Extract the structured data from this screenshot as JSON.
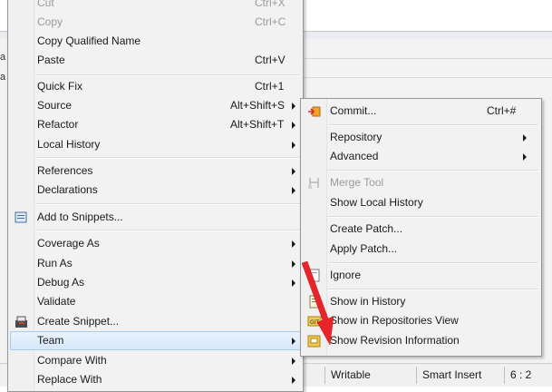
{
  "background": {
    "left_letters": [
      "a",
      "a"
    ],
    "status_bar": {
      "writable": "Writable",
      "insert_mode": "Smart Insert",
      "position": "6 : 2"
    }
  },
  "context_menu": {
    "items": [
      {
        "label": "Cut",
        "accelerator": "Ctrl+X",
        "disabled": true
      },
      {
        "label": "Copy",
        "accelerator": "Ctrl+C",
        "disabled": true
      },
      {
        "label": "Copy Qualified Name",
        "accelerator": ""
      },
      {
        "label": "Paste",
        "accelerator": "Ctrl+V"
      },
      {
        "label": "Quick Fix",
        "accelerator": "Ctrl+1"
      },
      {
        "label": "Source",
        "accelerator": "Alt+Shift+S",
        "submenu": true
      },
      {
        "label": "Refactor",
        "accelerator": "Alt+Shift+T",
        "submenu": true
      },
      {
        "label": "Local History",
        "submenu": true
      },
      {
        "label": "References",
        "submenu": true
      },
      {
        "label": "Declarations",
        "submenu": true
      },
      {
        "label": "Add to Snippets...",
        "icon": "snippet-icon"
      },
      {
        "label": "Coverage As",
        "submenu": true
      },
      {
        "label": "Run As",
        "submenu": true
      },
      {
        "label": "Debug As",
        "submenu": true
      },
      {
        "label": "Validate"
      },
      {
        "label": "Create Snippet...",
        "icon": "create-snippet-icon"
      },
      {
        "label": "Team",
        "submenu": true,
        "highlighted": true
      },
      {
        "label": "Compare With",
        "submenu": true
      },
      {
        "label": "Replace With",
        "submenu": true
      }
    ]
  },
  "team_submenu": {
    "items": [
      {
        "label": "Commit...",
        "accelerator": "Ctrl+#",
        "icon": "git-commit-icon"
      },
      {
        "label": "Repository",
        "submenu": true
      },
      {
        "label": "Advanced",
        "submenu": true
      },
      {
        "label": "Merge Tool",
        "disabled": true,
        "icon": "merge-tool-icon"
      },
      {
        "label": "Show Local History"
      },
      {
        "label": "Create Patch..."
      },
      {
        "label": "Apply Patch..."
      },
      {
        "label": "Ignore",
        "icon": "ignore-icon"
      },
      {
        "label": "Show in History",
        "icon": "history-icon"
      },
      {
        "label": "Show in Repositories View",
        "icon": "git-repositories-icon"
      },
      {
        "label": "Show Revision Information",
        "icon": "revision-info-icon"
      }
    ]
  },
  "colors": {
    "highlight": "#d7e8fb",
    "annotation_arrow": "#e8242a"
  }
}
